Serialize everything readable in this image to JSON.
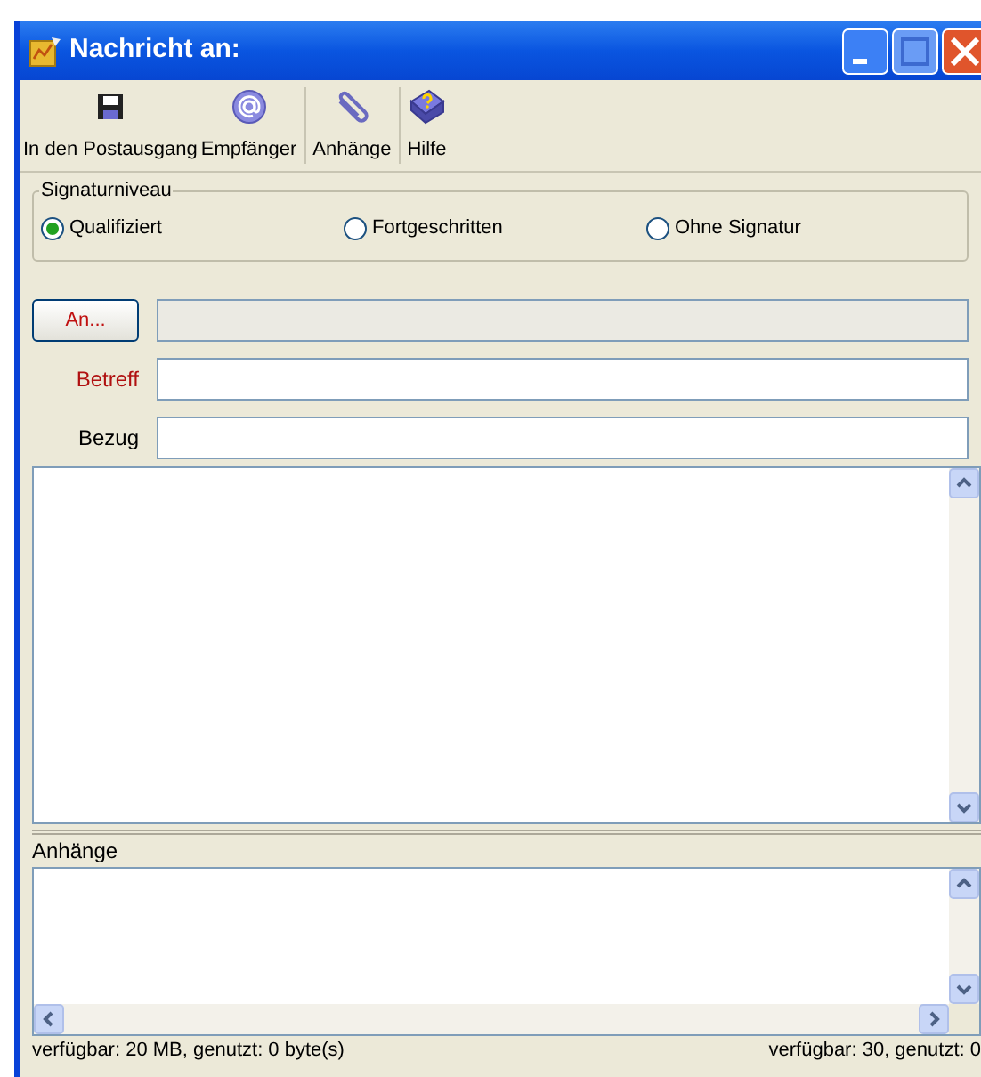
{
  "window": {
    "title": "Nachricht an:"
  },
  "toolbar": [
    {
      "label": "In den Postausgang",
      "separator_after": false
    },
    {
      "label": "Empfänger",
      "separator_after": true
    },
    {
      "label": "Anhänge",
      "separator_after": true
    },
    {
      "label": "Hilfe",
      "separator_after": false
    }
  ],
  "signature": {
    "legend": "Signaturniveau",
    "options": [
      {
        "label": "Qualifiziert",
        "selected": true
      },
      {
        "label": "Fortgeschritten",
        "selected": false
      },
      {
        "label": "Ohne Signatur",
        "selected": false
      }
    ]
  },
  "fields": [
    {
      "kind": "button",
      "label": "An...",
      "required": true,
      "disabled": true
    },
    {
      "kind": "label",
      "label": "Betreff",
      "required": true,
      "disabled": false
    },
    {
      "kind": "label",
      "label": "Bezug",
      "required": false,
      "disabled": false
    }
  ],
  "attachments": {
    "label": "Anhänge"
  },
  "status_bar": {
    "left": "verfügbar: 20 MB, genutzt: 0 byte(s)",
    "right": "verfügbar: 30, genutzt: 0"
  }
}
